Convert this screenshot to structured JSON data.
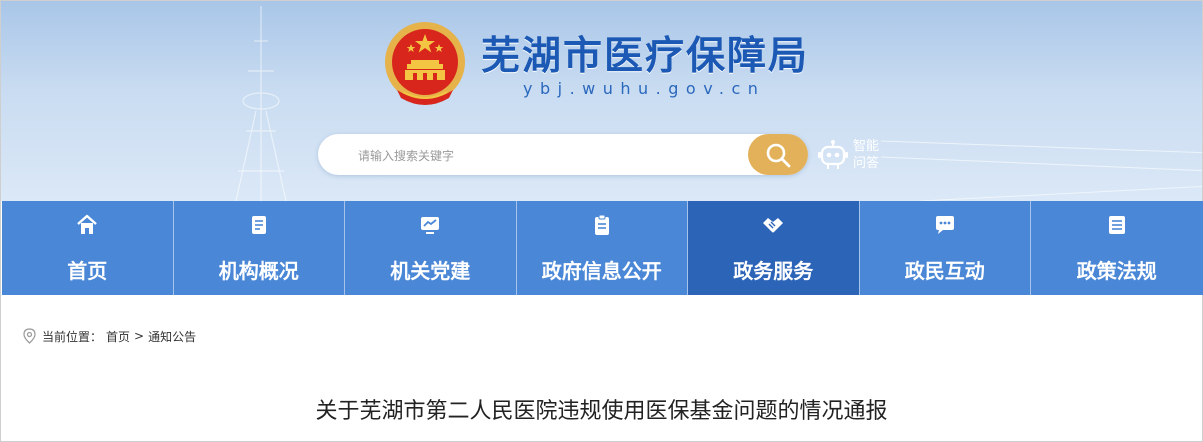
{
  "site": {
    "name": "芜湖市医疗保障局",
    "domain": "ybj.wuhu.gov.cn"
  },
  "search": {
    "placeholder": "请输入搜索关键字"
  },
  "assistant": {
    "label_line1": "智能",
    "label_line2": "问答"
  },
  "nav": {
    "items": [
      {
        "label": "首页",
        "icon": "home-icon"
      },
      {
        "label": "机构概况",
        "icon": "document-icon"
      },
      {
        "label": "机关党建",
        "icon": "monitor-chart-icon"
      },
      {
        "label": "政府信息公开",
        "icon": "clipboard-icon"
      },
      {
        "label": "政务服务",
        "icon": "handshake-icon",
        "active": true
      },
      {
        "label": "政民互动",
        "icon": "chat-icon"
      },
      {
        "label": "政策法规",
        "icon": "list-document-icon"
      }
    ]
  },
  "breadcrumb": {
    "prefix": "当前位置：",
    "home": "首页",
    "separator": ">",
    "current": "通知公告"
  },
  "article": {
    "title": "关于芜湖市第二人民医院违规使用医保基金问题的情况通报"
  },
  "colors": {
    "nav_bg": "#4a87d6",
    "nav_active": "#2c64b8",
    "search_button": "#e2b15a",
    "brand_text": "#1b59b4"
  }
}
